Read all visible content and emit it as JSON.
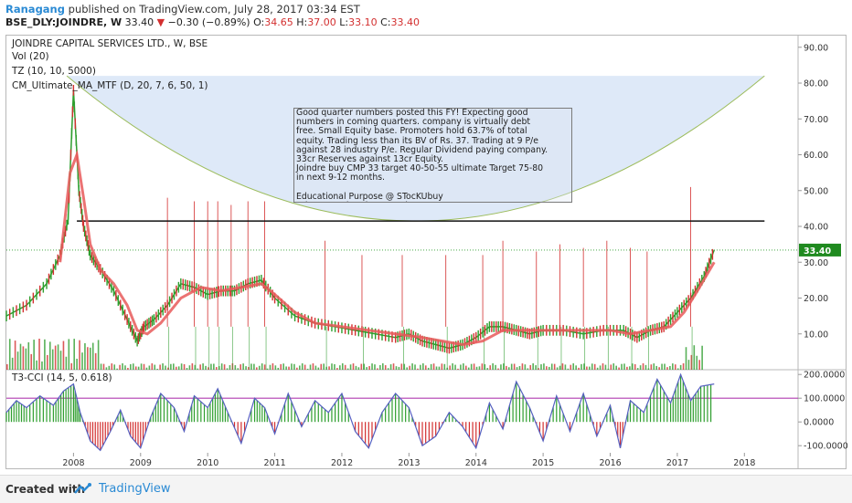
{
  "header": {
    "author": "Ranagang",
    "published_text": "published on TradingView.com, July 28, 2017 03:34 EST",
    "symbol": "BSE_DLY:JOINDRE, W",
    "price": "33.40",
    "change": "−0.30 (−0.89%)",
    "ohlc_o_label": "O:",
    "ohlc_o": "34.65",
    "ohlc_h_label": "H:",
    "ohlc_h": "37.00",
    "ohlc_l_label": "L:",
    "ohlc_l": "33.10",
    "ohlc_c_label": "C:",
    "ohlc_c": "33.40"
  },
  "legend": {
    "title": "JOINDRE CAPITAL SERVICES LTD., W, BSE",
    "vol": "Vol (20)",
    "tz": "TZ (10, 10, 5000)",
    "ma": "CM_Ultimate_MA_MTF (D, 20, 7, 6, 50, 1)",
    "cci": "T3-CCI (14, 5, 0.618)"
  },
  "note": {
    "text": "Good quarter numbers posted this FY! Expecting good\nnumbers in coming quarters. company is virtually debt\nfree. Small Equity base. Promoters hold 63.7% of total\nequity. Trading less than its BV of Rs. 37. Trading at 9 P/e\nagainst 28 industry P/e. Regular Dividend paying company.\n33cr Reserves against 13cr Equity.\nJoindre buy CMP 33 target 40-50-55 ultimate Target 75-80\nin next 9-12 months.\n\nEducational Purpose @ STocKUbuy\nTelegram @breakout Stocks"
  },
  "footer": {
    "created_with": "Created with",
    "brand": "TradingView"
  },
  "colors": {
    "up": "#2e9e2e",
    "down": "#d32f2f",
    "ma": "#e85a5a",
    "ma_up": "#6ed36e",
    "arc_fill": "#d6e3f6",
    "arc_line": "#9cbc5c",
    "cci_line": "#5560c0",
    "cci_level": "#b03cb0",
    "price_badge": "#1f8a1f",
    "volume_blue": "#7fbfe8"
  },
  "chart_data": {
    "type": "line",
    "title": "JOINDRE CAPITAL SERVICES LTD., W, BSE",
    "x_ticks": [
      "2008",
      "2009",
      "2010",
      "2011",
      "2012",
      "2013",
      "2014",
      "2015",
      "2016",
      "2017",
      "2018"
    ],
    "price_axis": {
      "ticks": [
        "10.00",
        "20.00",
        "30.00",
        "40.00",
        "50.00",
        "60.00",
        "70.00",
        "80.00",
        "90.00"
      ],
      "ylim": [
        0,
        93
      ]
    },
    "last_price": "33.40",
    "resistance_level": 41.5,
    "price_series": {
      "name": "",
      "x": [
        2007.0,
        2007.3,
        2007.6,
        2007.8,
        2007.92,
        2008.0,
        2008.08,
        2008.15,
        2008.25,
        2008.4,
        2008.6,
        2008.8,
        2008.95,
        2009.05,
        2009.2,
        2009.4,
        2009.6,
        2009.8,
        2010.0,
        2010.2,
        2010.4,
        2010.6,
        2010.8,
        2011.0,
        2011.3,
        2011.6,
        2011.9,
        2012.2,
        2012.5,
        2012.8,
        2013.0,
        2013.2,
        2013.4,
        2013.6,
        2013.8,
        2014.0,
        2014.2,
        2014.4,
        2014.6,
        2014.8,
        2015.0,
        2015.3,
        2015.6,
        2015.9,
        2016.2,
        2016.4,
        2016.6,
        2016.8,
        2017.0,
        2017.2,
        2017.4,
        2017.55
      ],
      "y": [
        15,
        18,
        24,
        32,
        42,
        78,
        50,
        40,
        32,
        28,
        22,
        14,
        8,
        12,
        14,
        18,
        24,
        23,
        21,
        22,
        22,
        24,
        25,
        20,
        15,
        13,
        12,
        11,
        10,
        9,
        10,
        8,
        7,
        6,
        7,
        9,
        12,
        12,
        11,
        10,
        11,
        11,
        10,
        11,
        11,
        9,
        11,
        12,
        16,
        20,
        26,
        33.4
      ]
    },
    "ma_series": {
      "name": "",
      "x": [
        2007.8,
        2007.95,
        2008.05,
        2008.15,
        2008.25,
        2008.4,
        2008.6,
        2008.8,
        2008.95,
        2009.1,
        2009.3,
        2009.6,
        2009.9,
        2010.2,
        2010.5,
        2010.8,
        2011.0,
        2011.3,
        2011.6,
        2012.0,
        2012.4,
        2012.8,
        2013.2,
        2013.5,
        2013.8,
        2014.1,
        2014.4,
        2014.8,
        2015.2,
        2015.6,
        2016.0,
        2016.3,
        2016.6,
        2016.9,
        2017.1,
        2017.3,
        2017.55
      ],
      "y": [
        30,
        55,
        60,
        48,
        35,
        28,
        24,
        18,
        11,
        10,
        13,
        20,
        23,
        22,
        23,
        24,
        21,
        16,
        13,
        12,
        11,
        10,
        9,
        8,
        7,
        8,
        11,
        11,
        11,
        11,
        11,
        10,
        11,
        12,
        16,
        22,
        30
      ]
    },
    "high_spikes": [
      {
        "x": 2009.4,
        "y": 48
      },
      {
        "x": 2009.8,
        "y": 47
      },
      {
        "x": 2010.0,
        "y": 47
      },
      {
        "x": 2010.15,
        "y": 47
      },
      {
        "x": 2010.35,
        "y": 46
      },
      {
        "x": 2010.6,
        "y": 47
      },
      {
        "x": 2010.85,
        "y": 47
      },
      {
        "x": 2011.75,
        "y": 36
      },
      {
        "x": 2012.3,
        "y": 32
      },
      {
        "x": 2012.9,
        "y": 32
      },
      {
        "x": 2013.55,
        "y": 32
      },
      {
        "x": 2014.1,
        "y": 32
      },
      {
        "x": 2014.4,
        "y": 36
      },
      {
        "x": 2014.9,
        "y": 33
      },
      {
        "x": 2015.25,
        "y": 35
      },
      {
        "x": 2015.6,
        "y": 34
      },
      {
        "x": 2015.95,
        "y": 36
      },
      {
        "x": 2016.3,
        "y": 34
      },
      {
        "x": 2016.55,
        "y": 33
      },
      {
        "x": 2017.2,
        "y": 51
      }
    ],
    "cci_axis": {
      "ticks": [
        "200.0000",
        "100.0000",
        "0.0000",
        "-100.0000"
      ],
      "ylim": [
        -130,
        220
      ],
      "level": 100
    },
    "cci_series": {
      "name": "",
      "x": [
        2007.0,
        2007.15,
        2007.3,
        2007.5,
        2007.7,
        2007.85,
        2008.0,
        2008.1,
        2008.25,
        2008.4,
        2008.55,
        2008.7,
        2008.85,
        2009.0,
        2009.15,
        2009.3,
        2009.5,
        2009.65,
        2009.8,
        2010.0,
        2010.15,
        2010.3,
        2010.5,
        2010.7,
        2010.85,
        2011.0,
        2011.2,
        2011.4,
        2011.6,
        2011.8,
        2012.0,
        2012.2,
        2012.4,
        2012.6,
        2012.8,
        2013.0,
        2013.2,
        2013.4,
        2013.6,
        2013.8,
        2014.0,
        2014.2,
        2014.4,
        2014.6,
        2014.8,
        2015.0,
        2015.2,
        2015.4,
        2015.6,
        2015.8,
        2016.0,
        2016.15,
        2016.3,
        2016.5,
        2016.7,
        2016.9,
        2017.05,
        2017.2,
        2017.35,
        2017.55
      ],
      "y": [
        40,
        90,
        60,
        110,
        70,
        130,
        160,
        40,
        -80,
        -120,
        -40,
        50,
        -60,
        -110,
        20,
        120,
        60,
        -40,
        110,
        60,
        140,
        40,
        -90,
        100,
        60,
        -50,
        120,
        -20,
        90,
        40,
        120,
        -40,
        -110,
        40,
        120,
        60,
        -100,
        -60,
        40,
        -20,
        -110,
        80,
        -30,
        170,
        60,
        -80,
        110,
        -40,
        120,
        -60,
        70,
        -110,
        90,
        40,
        180,
        80,
        200,
        90,
        150,
        160
      ]
    }
  }
}
